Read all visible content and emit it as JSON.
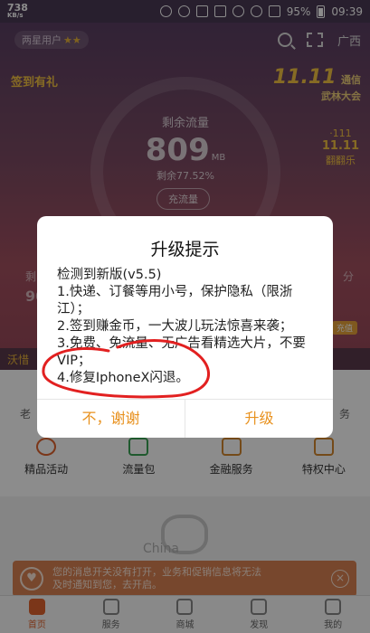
{
  "status_bar": {
    "speed_value": "738",
    "speed_unit": "KB/s",
    "battery": "95%",
    "time": "09:39"
  },
  "header": {
    "user_level": "两星用户",
    "stars": "★★",
    "region": "广西",
    "icons": [
      "search-icon",
      "scan-icon"
    ]
  },
  "gauge": {
    "label": "剩余流量",
    "value": "809",
    "unit": "MB",
    "remaining": "剩余77.52%",
    "button": "充流量"
  },
  "promos": {
    "left": "签到有礼",
    "right_big": "11.11",
    "right_small": "通信",
    "right_sub": "武林大会",
    "right2_top": "11.11",
    "right2_bottom": "翻翻乐",
    "right2_tag": "·111"
  },
  "side_info": {
    "left_label": "剩",
    "left_value": "90",
    "right_label": "分",
    "right_tag": "充值"
  },
  "banner_strip": "沃惜",
  "grid": {
    "ghost_left": "老",
    "ghost_right": "务",
    "items": [
      {
        "label": "精品活动",
        "icon": "gift-ring-icon"
      },
      {
        "label": "流量包",
        "icon": "chart-icon"
      },
      {
        "label": "金融服务",
        "icon": "crown-icon"
      },
      {
        "label": "特权中心",
        "icon": "bag-icon"
      }
    ]
  },
  "brand": {
    "text": "China"
  },
  "notice": {
    "line1": "您的消息开关没有打开，业务和促销信息将无法",
    "line2": "及时通知到您，去开启。",
    "close": "×",
    "heart": "♥"
  },
  "tabbar": {
    "tabs": [
      {
        "label": "首页",
        "active": true
      },
      {
        "label": "服务",
        "active": false
      },
      {
        "label": "商城",
        "active": false
      },
      {
        "label": "发现",
        "active": false
      },
      {
        "label": "我的",
        "active": false
      }
    ]
  },
  "dialog": {
    "title": "升级提示",
    "lines": [
      "检测到新版(v5.5)",
      "1.快递、订餐等用小号，保护隐私（限浙江）；",
      "2.签到赚金币，一大波儿玩法惊喜来袭；",
      "3.免费、免流量、无广告看精选大片，不要VIP；",
      "4.修复IphoneX闪退。"
    ],
    "cancel": "不，谢谢",
    "confirm": "升级"
  },
  "colors": {
    "accent": "#e8911e",
    "annotation": "#e22020"
  }
}
